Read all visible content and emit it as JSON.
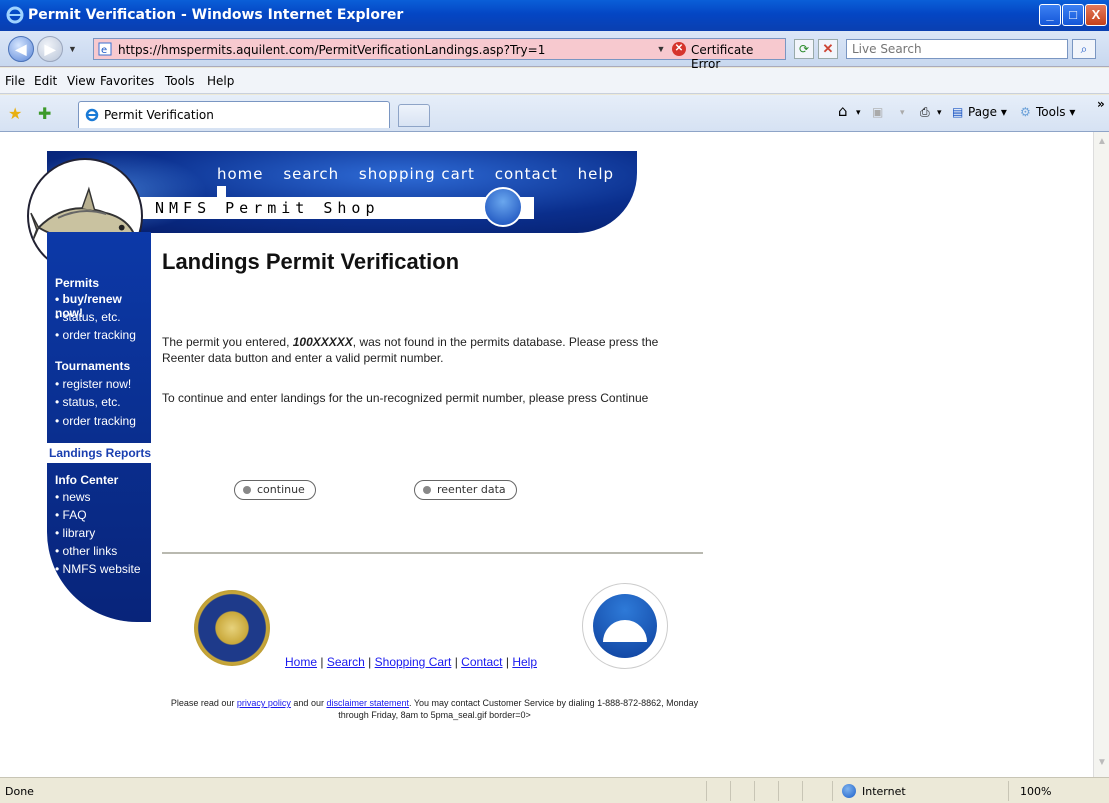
{
  "window": {
    "title": "Permit Verification - Windows Internet Explorer",
    "min": "_",
    "max": "□",
    "close": "X"
  },
  "address": {
    "url": "https://hmspermits.aquilent.com/PermitVerificationLandings.asp?Try=1",
    "cert_error": "Certificate Error"
  },
  "search": {
    "placeholder": "Live Search"
  },
  "menu": [
    "File",
    "Edit",
    "View",
    "Favorites",
    "Tools",
    "Help"
  ],
  "tab": {
    "label": "Permit Verification"
  },
  "commands": {
    "page": "Page ▾",
    "tools": "Tools ▾"
  },
  "site": {
    "nav": [
      "home",
      "search",
      "shopping cart",
      "contact",
      "help"
    ],
    "shop_name": "NMFS Permit Shop"
  },
  "sidebar": {
    "permits": {
      "heading": "Permits",
      "items": [
        "• buy/renew now!",
        "• status, etc.",
        "• order tracking"
      ]
    },
    "tournaments": {
      "heading": "Tournaments",
      "items": [
        "• register now!",
        "• status, etc.",
        "• order tracking"
      ]
    },
    "landings": "Landings Reports",
    "info": {
      "heading": "Info Center",
      "items": [
        "• news",
        "• FAQ",
        "• library",
        "• other links",
        "• NMFS website"
      ]
    }
  },
  "main": {
    "title": "Landings Permit Verification",
    "msg1_pre": "The permit you entered, ",
    "msg1_permit": "100XXXXX",
    "msg1_post": ", was not found in the permits database. Please press the Reenter data button and enter a valid permit number.",
    "msg2": "To continue and enter landings for the un-recognized permit number, please press Continue",
    "continue_label": "continue",
    "reenter_label": "reenter data"
  },
  "footer": {
    "links": [
      "Home",
      "Search",
      "Shopping Cart",
      "Contact",
      "Help"
    ],
    "sep": " | ",
    "disc_pre": "Please read our ",
    "privacy": "privacy policy",
    "disc_mid": " and our ",
    "disclaimer": "disclaimer statement",
    "disc_post": ". You may contact Customer Service by dialing 1-888-872-8862, Monday through Friday, 8am to 5pma_seal.gif border=0>"
  },
  "status": {
    "text": "Done",
    "zone": "Internet",
    "zoom": "100%"
  }
}
